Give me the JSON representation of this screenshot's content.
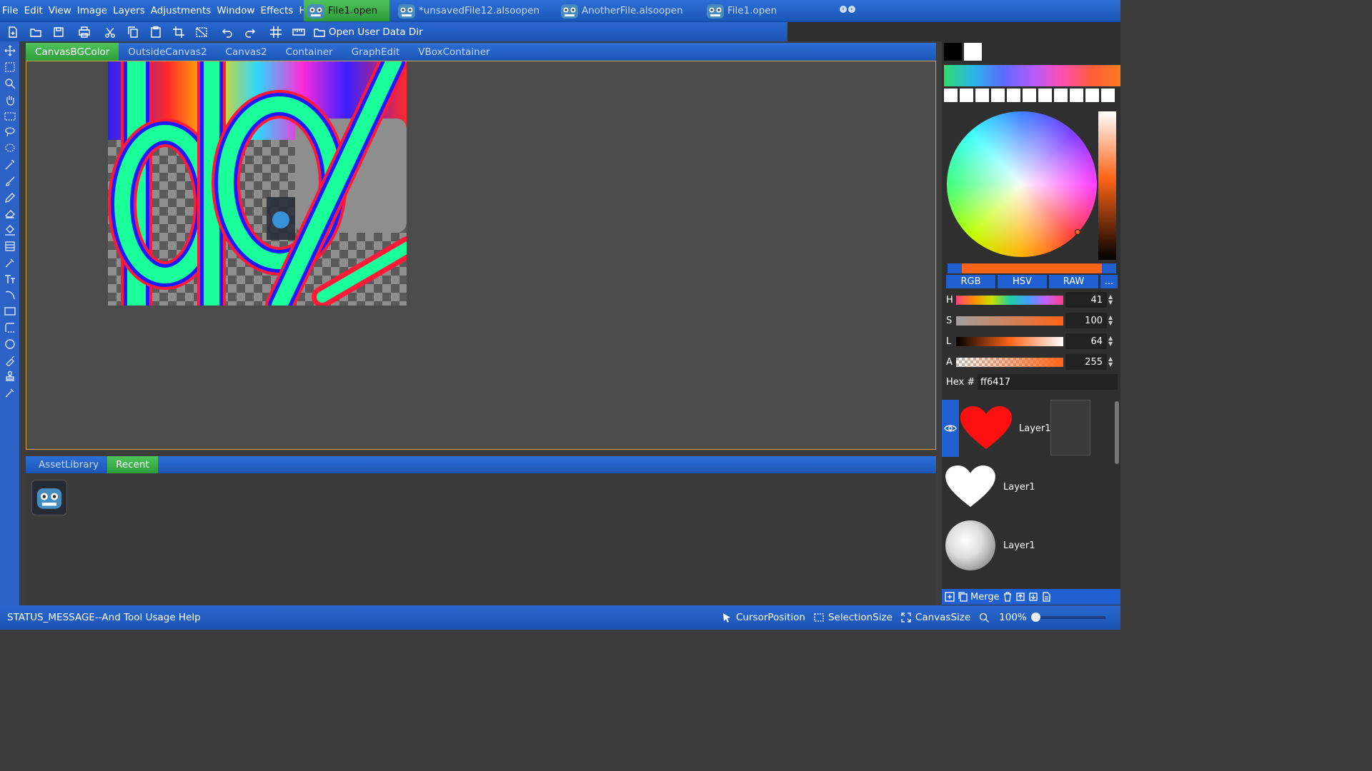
{
  "menu": [
    "File",
    "Edit",
    "View",
    "Image",
    "Layers",
    "Adjustments",
    "Window",
    "Effects",
    "Help"
  ],
  "file_tabs": [
    {
      "label": "File1.open",
      "active": true
    },
    {
      "label": "*unsavedFile12.alsoopen",
      "active": false
    },
    {
      "label": "AnotherFile.alsoopen",
      "active": false
    },
    {
      "label": "File1.open",
      "active": false
    }
  ],
  "toolbar": {
    "icons": [
      "new-file-icon",
      "open-folder-icon",
      "save-icon",
      "print-icon",
      "cut-icon",
      "copy-icon",
      "paste-icon",
      "crop-icon",
      "select-none-icon",
      "undo-icon",
      "redo-icon",
      "grid-icon",
      "ruler-icon"
    ],
    "open_dir_label": "Open User Data Dir"
  },
  "tools": [
    "move-icon",
    "rect-select-icon",
    "zoom-icon",
    "hand-icon",
    "select-icon",
    "lasso-icon",
    "magic-lasso-icon",
    "magic-wand-icon",
    "brush-icon",
    "pencil-icon",
    "eraser-icon",
    "bucket-icon",
    "gradient-icon",
    "eyedropper-icon",
    "text-icon",
    "curve-icon",
    "rectangle-icon",
    "rounded-rect-icon",
    "ellipse-icon",
    "smudge-icon",
    "stamp-icon",
    "color-picker-icon"
  ],
  "canvas_tabs": [
    {
      "label": "CanvasBGColor",
      "active": true
    },
    {
      "label": "OutsideCanvas2",
      "active": false
    },
    {
      "label": "Canvas2",
      "active": false
    },
    {
      "label": "Container",
      "active": false
    },
    {
      "label": "GraphEdit",
      "active": false
    },
    {
      "label": "VBoxContainer",
      "active": false
    }
  ],
  "dock_tabs": [
    {
      "label": "AssetLibrary",
      "active": false
    },
    {
      "label": "Recent",
      "active": true
    }
  ],
  "color": {
    "hex_label": "Hex #",
    "hex_value": "ff6417",
    "current": "#ff6417",
    "modes": [
      "RGB",
      "HSV",
      "RAW",
      "..."
    ],
    "sliders": [
      {
        "label": "H",
        "value": "41"
      },
      {
        "label": "S",
        "value": "100"
      },
      {
        "label": "L",
        "value": "64"
      },
      {
        "label": "A",
        "value": "255"
      }
    ]
  },
  "layers": [
    {
      "name": "Layer1",
      "thumb": "red-heart"
    },
    {
      "name": "Layer1",
      "thumb": "white-heart"
    },
    {
      "name": "Layer1",
      "thumb": "white-sphere"
    }
  ],
  "layer_buttons": {
    "merge_label": "Merge"
  },
  "status": {
    "message": "STATUS_MESSAGE--And Tool Usage Help",
    "cursor": "CursorPosition",
    "selection": "SelectionSize",
    "canvas_size": "CanvasSize",
    "zoom": "100%"
  },
  "colors": {
    "accent": "#1f5fcf",
    "active_tab": "#3fae4b",
    "canvas_border": "#d6a43a"
  }
}
